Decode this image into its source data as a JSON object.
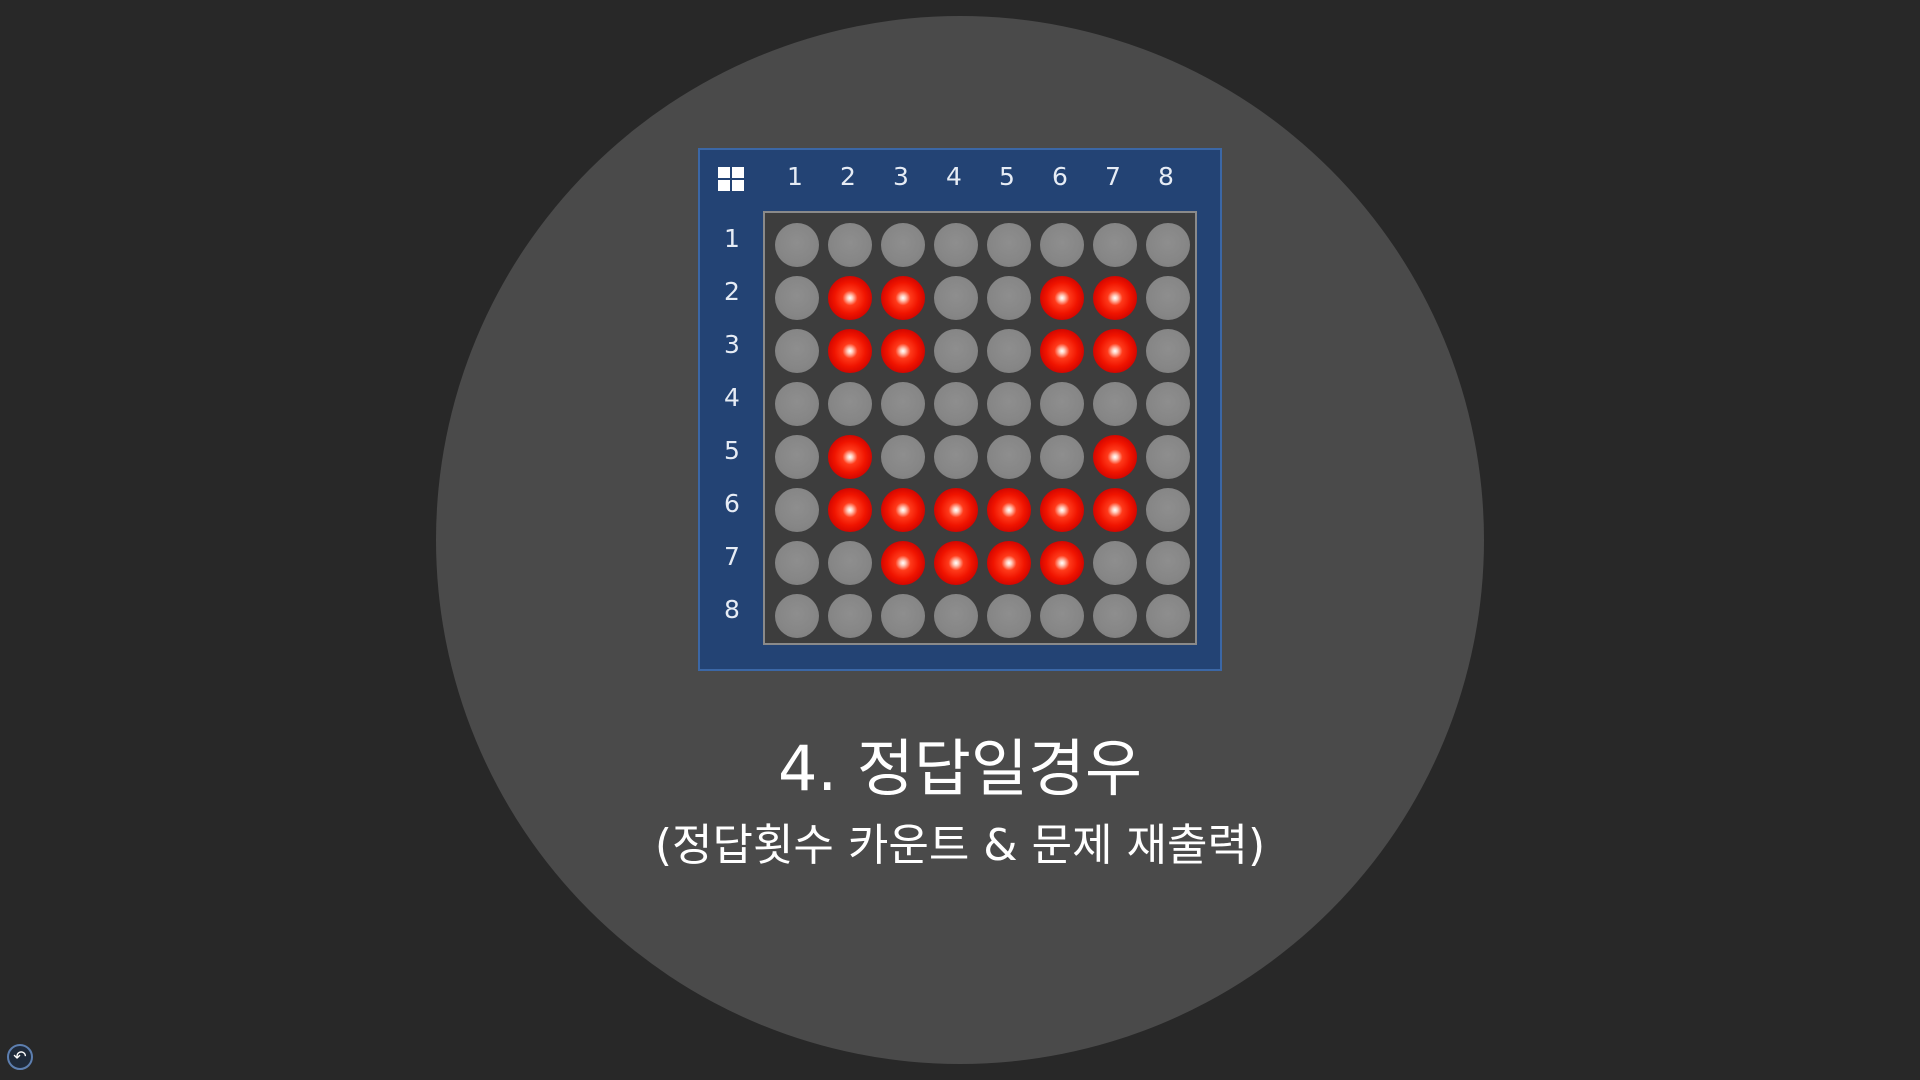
{
  "matrix": {
    "corner_icon": "grid-icon",
    "column_labels": [
      "1",
      "2",
      "3",
      "4",
      "5",
      "6",
      "7",
      "8"
    ],
    "row_labels": [
      "1",
      "2",
      "3",
      "4",
      "5",
      "6",
      "7",
      "8"
    ],
    "leds": [
      [
        0,
        0,
        0,
        0,
        0,
        0,
        0,
        0
      ],
      [
        0,
        1,
        1,
        0,
        0,
        1,
        1,
        0
      ],
      [
        0,
        1,
        1,
        0,
        0,
        1,
        1,
        0
      ],
      [
        0,
        0,
        0,
        0,
        0,
        0,
        0,
        0
      ],
      [
        0,
        1,
        0,
        0,
        0,
        0,
        1,
        0
      ],
      [
        0,
        1,
        1,
        1,
        1,
        1,
        1,
        0
      ],
      [
        0,
        0,
        1,
        1,
        1,
        1,
        0,
        0
      ],
      [
        0,
        0,
        0,
        0,
        0,
        0,
        0,
        0
      ]
    ],
    "colors": {
      "panel": "#234374",
      "led_on": "#f01400",
      "led_off": "#868686"
    }
  },
  "slide": {
    "title": "4. 정답일경우",
    "subtitle": "(정답횟수 카운트 & 문제 재출력)"
  },
  "nav": {
    "back_icon": "back-arrow-icon",
    "back_glyph": "↶"
  }
}
